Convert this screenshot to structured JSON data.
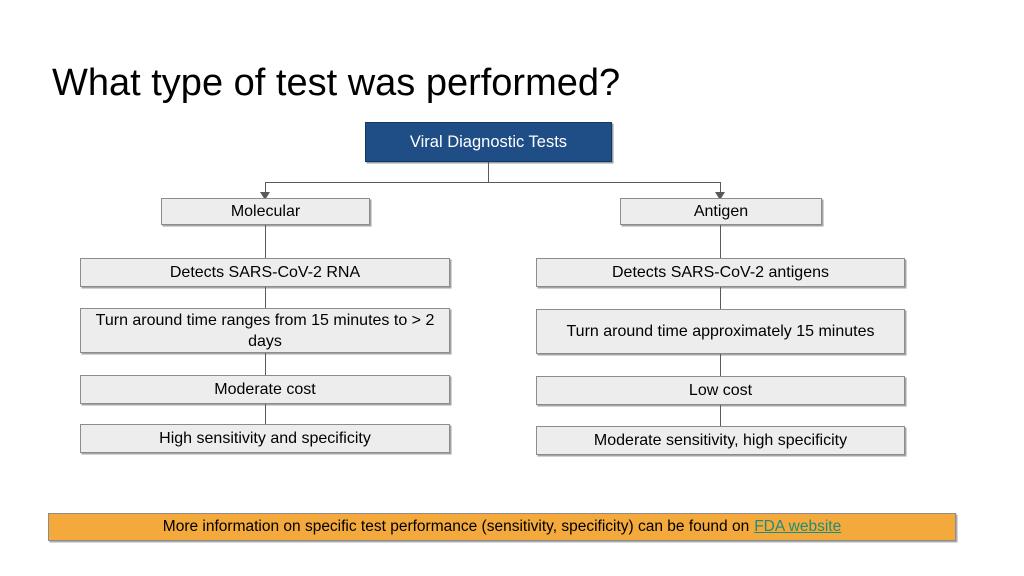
{
  "slide": {
    "title": "What type of test was performed?"
  },
  "diagram": {
    "root": {
      "label": "Viral Diagnostic Tests"
    },
    "branches": [
      {
        "name": "molecular",
        "header": "Molecular",
        "items": [
          "Detects SARS-CoV-2 RNA",
          "Turn around time ranges from 15 minutes to > 2 days",
          "Moderate cost",
          "High sensitivity and specificity"
        ]
      },
      {
        "name": "antigen",
        "header": "Antigen",
        "items": [
          "Detects SARS-CoV-2 antigens",
          "Turn around time approximately 15 minutes",
          "Low cost",
          "Moderate sensitivity, high specificity"
        ]
      }
    ]
  },
  "footer": {
    "text": "More information on specific test performance (sensitivity, specificity) can be found on",
    "link_label": "FDA website"
  },
  "colors": {
    "root_box_fill": "#1f4e87",
    "box_fill": "#ededed",
    "box_border": "#8c8c8c",
    "connector": "#595959",
    "footer_fill": "#f4a93c",
    "link": "#1f8c7a",
    "text": "#000000"
  }
}
